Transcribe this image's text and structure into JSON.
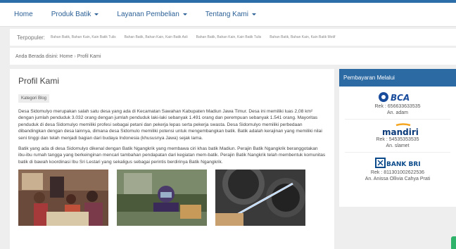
{
  "nav": {
    "items": [
      {
        "label": "Home",
        "dropdown": false
      },
      {
        "label": "Produk Batik",
        "dropdown": true
      },
      {
        "label": "Layanan Pembelian",
        "dropdown": true
      },
      {
        "label": "Tentang Kami",
        "dropdown": true
      }
    ]
  },
  "popular": {
    "label": "Terpopuler:",
    "links": [
      "Bahan Batik, Bahan Kain, Kain Batik Tulis",
      "Bahan Batik, Bahan Kain, Kain Batik Asli",
      "Bahan Batik, Bahan Kain, Kain Batik Tulis",
      "Bahan Batik, Bahan Kain, Kain Batik Motif"
    ]
  },
  "breadcrumb": {
    "prefix": "Anda Berada disini:",
    "home": "Home",
    "separator": "›",
    "current": "Profil Kami"
  },
  "main": {
    "title": "Profil Kami",
    "category": "Kategori Blog",
    "paragraph1": "Desa Sidomulyo merupakan salah satu desa yang ada di Kecamatan Sawahan Kabupaten Madiun Jawa Timur. Desa ini memiliki luas 2,08 km² dengan jumlah penduduk 3.032 orang dengan jumlah penduduk laki-laki sebanyak 1.491 orang dan perempuan sebanyak 1.541 orang. Mayoritas penduduk di desa Sidomulyo memiliki profesi sebagai petani dan pekerja lepas serta pekerja swasta. Desa Sidomulyo memiliki perbedaan dibandingkan dengan desa lainnya, dimana desa Sidomulo memiliki potensi untuk mengembangkan batik. Batik adalah kerajinan yang memiliki nilai seni tinggi dan telah menjadi bagian dari budaya Indonesia (khususnya Jawa) sejak lama.",
    "paragraph2": "Batik yang ada di desa Sidomulyo dikenal dengan Batik Ngangkrik yang membawa ciri khas batik Madiun. Perajin Batik Ngangkrik beranggotakan ibu-ibu rumah tangga yang berkeinginan mencari tambahan pendapatan dari kegiatan mem-batik. Perajin Batik Nangkrik telah membentuk komunitas batik di bawah koordinasi Ibu Sri Lestari yang sekaligus sebagai perintis berdirinya Batik Ngangkrik."
  },
  "sidebar": {
    "title": "Pembayaran Melalui",
    "banks": [
      {
        "name": "BCA",
        "icon": "bca-logo-icon",
        "rek": "Rek : 656633633535",
        "holder": "An. adam",
        "color": "#1a4c9c"
      },
      {
        "name": "mandiri",
        "icon": "mandiri-logo-icon",
        "rek": "Rek : 54535353535",
        "holder": "An. slamet",
        "color": "#0a3a7a",
        "accent": "#f5a623"
      },
      {
        "name": "BANK BRI",
        "icon": "bri-logo-icon",
        "rek": "Rek : 811301002622536",
        "holder": "An. Anissa Ollivia Cahya Prati",
        "color": "#0a4a8a"
      }
    ]
  },
  "colors": {
    "nav_top": "#2b6ea8",
    "sidebar_header": "#2c6aa3",
    "link": "#2a5f96"
  }
}
